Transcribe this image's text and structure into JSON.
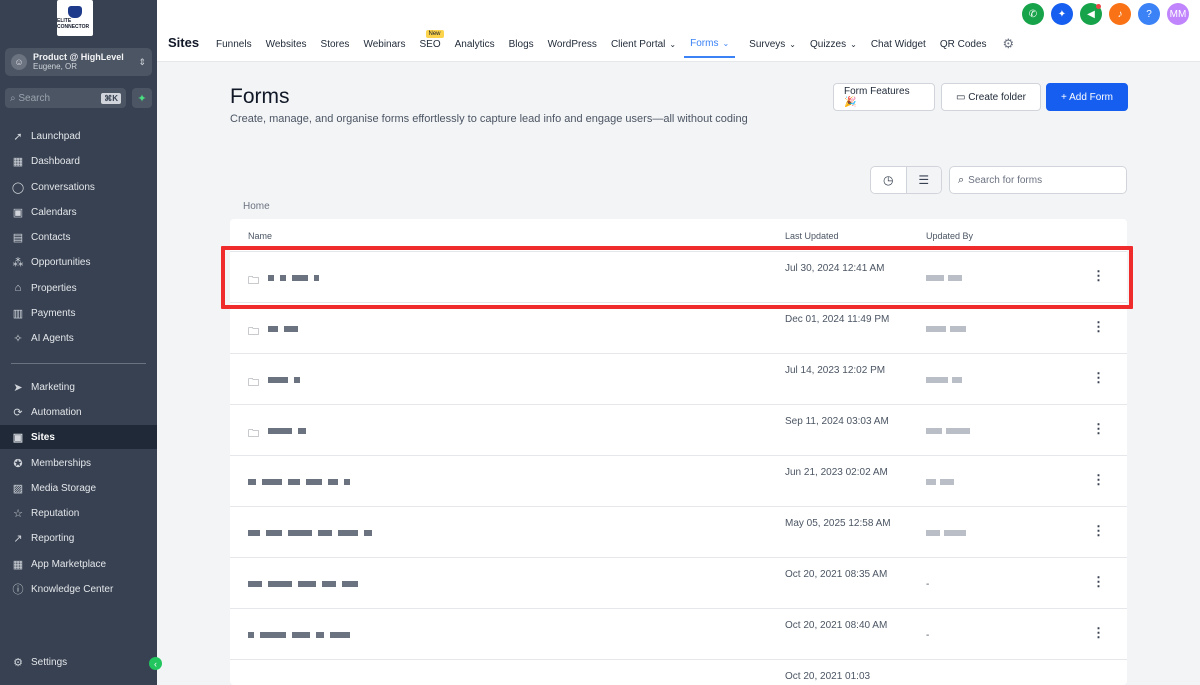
{
  "sidebar": {
    "logo_text": "ELITE CONNECTOR",
    "account": {
      "name": "Product @ HighLevel",
      "location": "Eugene, OR"
    },
    "search_placeholder": "Search",
    "search_shortcut": "⌘K",
    "items": [
      {
        "label": "Launchpad",
        "icon": "rocket-icon"
      },
      {
        "label": "Dashboard",
        "icon": "grid-icon"
      },
      {
        "label": "Conversations",
        "icon": "chat-icon"
      },
      {
        "label": "Calendars",
        "icon": "calendar-icon"
      },
      {
        "label": "Contacts",
        "icon": "contact-card-icon"
      },
      {
        "label": "Opportunities",
        "icon": "network-icon"
      },
      {
        "label": "Properties",
        "icon": "home-icon"
      },
      {
        "label": "Payments",
        "icon": "receipt-icon"
      },
      {
        "label": "AI Agents",
        "icon": "sparkles-icon"
      },
      {
        "label": "Marketing",
        "icon": "send-icon"
      },
      {
        "label": "Automation",
        "icon": "automation-icon"
      },
      {
        "label": "Sites",
        "icon": "site-icon",
        "active": true
      },
      {
        "label": "Memberships",
        "icon": "badge-icon"
      },
      {
        "label": "Media Storage",
        "icon": "image-icon"
      },
      {
        "label": "Reputation",
        "icon": "star-icon"
      },
      {
        "label": "Reporting",
        "icon": "trend-icon"
      },
      {
        "label": "App Marketplace",
        "icon": "apps-icon"
      },
      {
        "label": "Knowledge Center",
        "icon": "info-icon"
      }
    ],
    "settings_label": "Settings"
  },
  "topbar": {
    "title": "Sites",
    "tabs": [
      {
        "label": "Funnels"
      },
      {
        "label": "Websites"
      },
      {
        "label": "Stores"
      },
      {
        "label": "Webinars"
      },
      {
        "label": "SEO",
        "badge": "New"
      },
      {
        "label": "Analytics"
      },
      {
        "label": "Blogs"
      },
      {
        "label": "WordPress"
      },
      {
        "label": "Client Portal",
        "dropdown": true
      },
      {
        "label": "Forms",
        "dropdown": true,
        "active": true
      },
      {
        "label": "Surveys",
        "dropdown": true
      },
      {
        "label": "Quizzes",
        "dropdown": true
      },
      {
        "label": "Chat Widget"
      },
      {
        "label": "QR Codes"
      }
    ],
    "avatar_initials": "MM",
    "help_label": "?"
  },
  "colors": {
    "sidebar_bg": "#374151",
    "primary": "#155eef",
    "active_tab": "#3b82f6",
    "highlight": "#ef2b2b",
    "phone_green": "#16a34a",
    "notification_orange": "#f97316",
    "avatar_purple": "#c084fc"
  },
  "page": {
    "title": "Forms",
    "description": "Create, manage, and organise forms effortlessly to capture lead info and engage users—all without coding",
    "buttons": {
      "features": "Form Features 🎉",
      "create_folder": "Create folder",
      "add_form": "+ Add Form"
    },
    "search_placeholder": "Search for forms",
    "breadcrumb": "Home"
  },
  "table": {
    "columns": [
      "Name",
      "Last Updated",
      "Updated By"
    ],
    "rows": [
      {
        "type": "folder",
        "last_updated": "Jul 30, 2024 12:41 AM",
        "updated_by": "",
        "highlighted": true
      },
      {
        "type": "folder",
        "last_updated": "Dec 01, 2024 11:49 PM",
        "updated_by": ""
      },
      {
        "type": "folder",
        "last_updated": "Jul 14, 2023 12:02 PM",
        "updated_by": ""
      },
      {
        "type": "folder",
        "last_updated": "Sep 11, 2024 03:03 AM",
        "updated_by": ""
      },
      {
        "type": "form",
        "last_updated": "Jun 21, 2023 02:02 AM",
        "updated_by": ""
      },
      {
        "type": "form",
        "last_updated": "May 05, 2025 12:58 AM",
        "updated_by": ""
      },
      {
        "type": "form",
        "last_updated": "Oct 20, 2021 08:35 AM",
        "updated_by": "-"
      },
      {
        "type": "form",
        "last_updated": "Oct 20, 2021 08:40 AM",
        "updated_by": "-"
      },
      {
        "type": "form",
        "last_updated": "Oct 20, 2021 01:03",
        "updated_by": ""
      }
    ]
  }
}
